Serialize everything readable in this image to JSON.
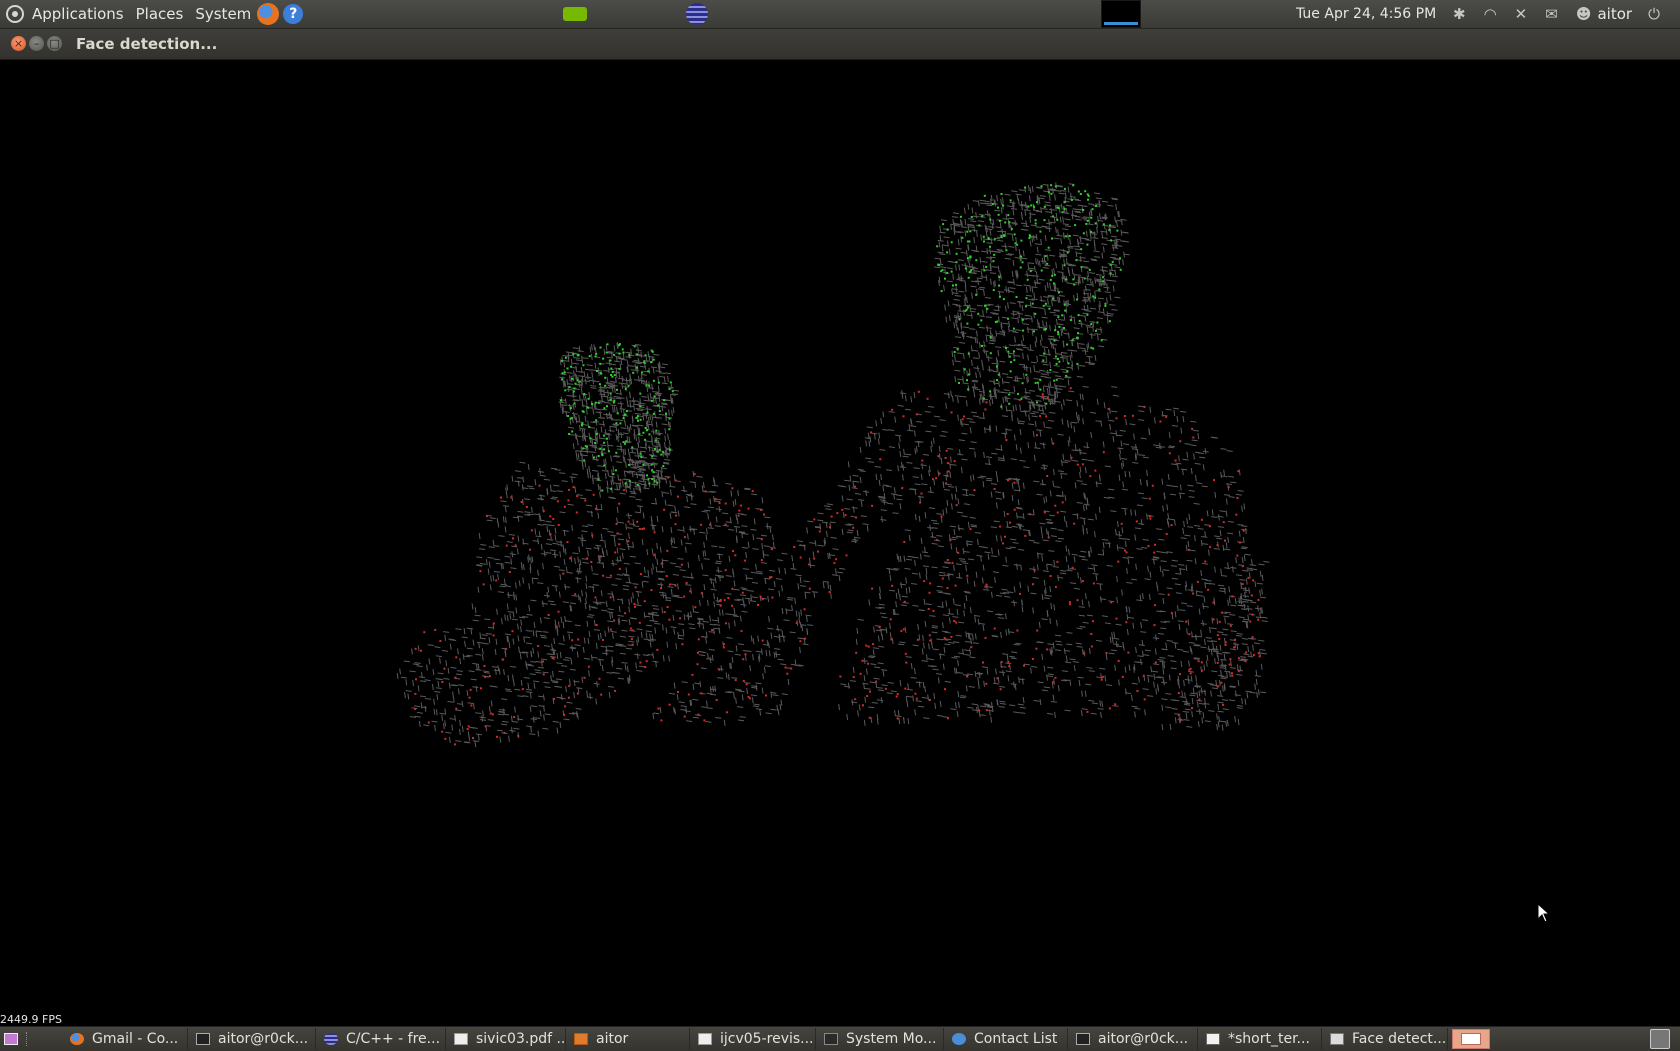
{
  "top_panel": {
    "menus": [
      "Applications",
      "Places",
      "System"
    ],
    "help_glyph": "?",
    "clock": "Tue Apr 24,  4:56 PM",
    "user": "aitor",
    "icons": [
      "ubuntu-logo",
      "firefox-icon",
      "help-icon",
      "nvidia-icon",
      "eclipse-icon",
      "system-monitor-graph",
      "bluetooth-icon",
      "wifi-icon",
      "volume-muted-icon",
      "mail-icon",
      "chat-status-icon",
      "power-icon"
    ]
  },
  "window": {
    "title": "Face detection...",
    "controls": [
      "close",
      "minimize",
      "maximize"
    ]
  },
  "viewer": {
    "fps": "2449.9 FPS",
    "colors": {
      "mesh": "#5a5a5a",
      "face_points": "#2fd12f",
      "body_points": "#d42a2a",
      "background": "#000000"
    }
  },
  "taskbar": {
    "tasks": [
      {
        "label": "Gmail - Co...",
        "icon": "ff"
      },
      {
        "label": "aitor@r0ck...",
        "icon": "term"
      },
      {
        "label": "C/C++ - fre...",
        "icon": "eclipse"
      },
      {
        "label": "sivic03.pdf ...",
        "icon": "doc"
      },
      {
        "label": "aitor",
        "icon": "folder"
      },
      {
        "label": "ijcv05-revis...",
        "icon": "doc"
      },
      {
        "label": "System Mo...",
        "icon": "monitor"
      },
      {
        "label": "Contact List",
        "icon": "contact"
      },
      {
        "label": "aitor@r0ck...",
        "icon": "term"
      },
      {
        "label": "*short_ter...",
        "icon": "edit"
      },
      {
        "label": "Face detect...",
        "icon": "win"
      }
    ]
  }
}
